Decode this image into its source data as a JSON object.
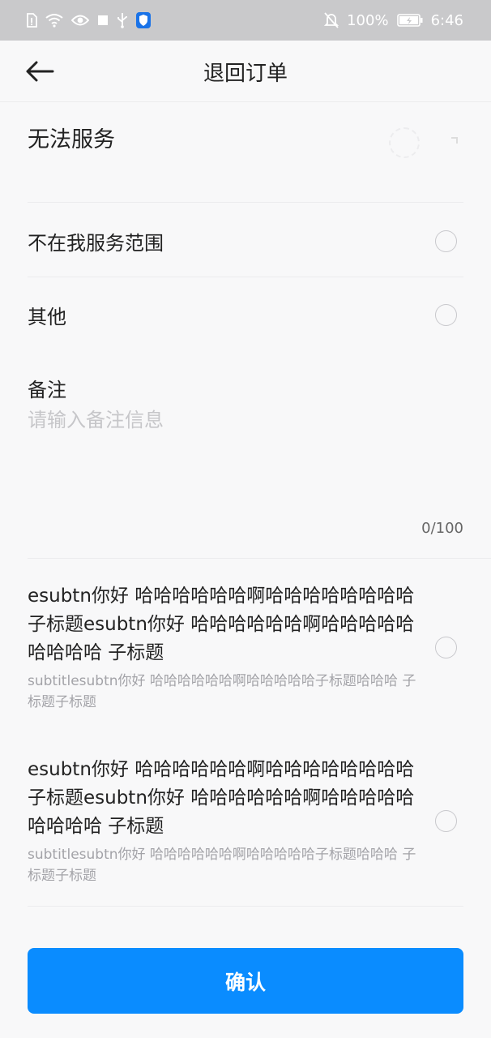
{
  "status_bar": {
    "battery_percent": "100%",
    "time": "6:46",
    "icons_left": [
      "sim-icon",
      "wifi-icon",
      "eye-icon",
      "square-icon",
      "usb-icon",
      "shield-icon"
    ],
    "icons_right": [
      "bell-off-icon",
      "battery-icon"
    ]
  },
  "header": {
    "title": "退回订单"
  },
  "section": {
    "title": "无法服务"
  },
  "options": [
    {
      "label": "不在我服务范围"
    },
    {
      "label": "其他"
    }
  ],
  "remark": {
    "label": "备注",
    "placeholder": "请输入备注信息",
    "value": "",
    "counter": "0/100"
  },
  "rich_options": [
    {
      "title": "esubtn你好  哈哈哈哈哈哈啊哈哈哈哈哈哈哈哈 子标题esubtn你好  哈哈哈哈哈哈啊哈哈哈哈哈哈哈哈哈 子标题",
      "subtitle": "subtitlesubtn你好  哈哈哈哈哈哈啊哈哈哈哈哈子标题哈哈哈 子标题子标题"
    },
    {
      "title": "esubtn你好  哈哈哈哈哈哈啊哈哈哈哈哈哈哈哈 子标题esubtn你好  哈哈哈哈哈哈啊哈哈哈哈哈哈哈哈哈 子标题",
      "subtitle": "subtitlesubtn你好  哈哈哈哈哈哈啊哈哈哈哈哈子标题哈哈哈 子标题子标题"
    }
  ],
  "confirm_button": {
    "label": "确认"
  },
  "colors": {
    "primary": "#0a8cff",
    "status_bar": "#c9c9cb",
    "background": "#f8f8f9"
  }
}
